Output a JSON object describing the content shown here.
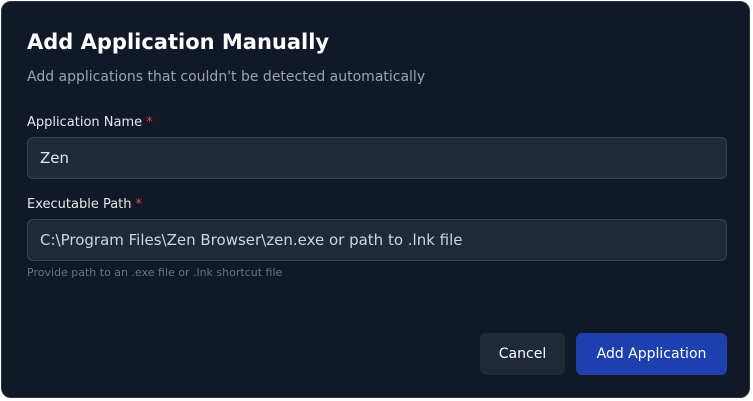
{
  "dialog": {
    "title": "Add Application Manually",
    "subtitle": "Add applications that couldn't be detected automatically"
  },
  "form": {
    "name_label": "Application Name",
    "name_value": "Zen",
    "path_label": "Executable Path",
    "path_placeholder": "C:\\Program Files\\Zen Browser\\zen.exe or path to .lnk file",
    "path_value": "",
    "required_marker": "*",
    "path_hint": "Provide path to an .exe file or .lnk shortcut file"
  },
  "actions": {
    "cancel_label": "Cancel",
    "add_label": "Add Application"
  },
  "colors": {
    "background": "#111827",
    "field_background": "#1f2937",
    "required": "#ef4444",
    "primary": "#1e40af"
  }
}
